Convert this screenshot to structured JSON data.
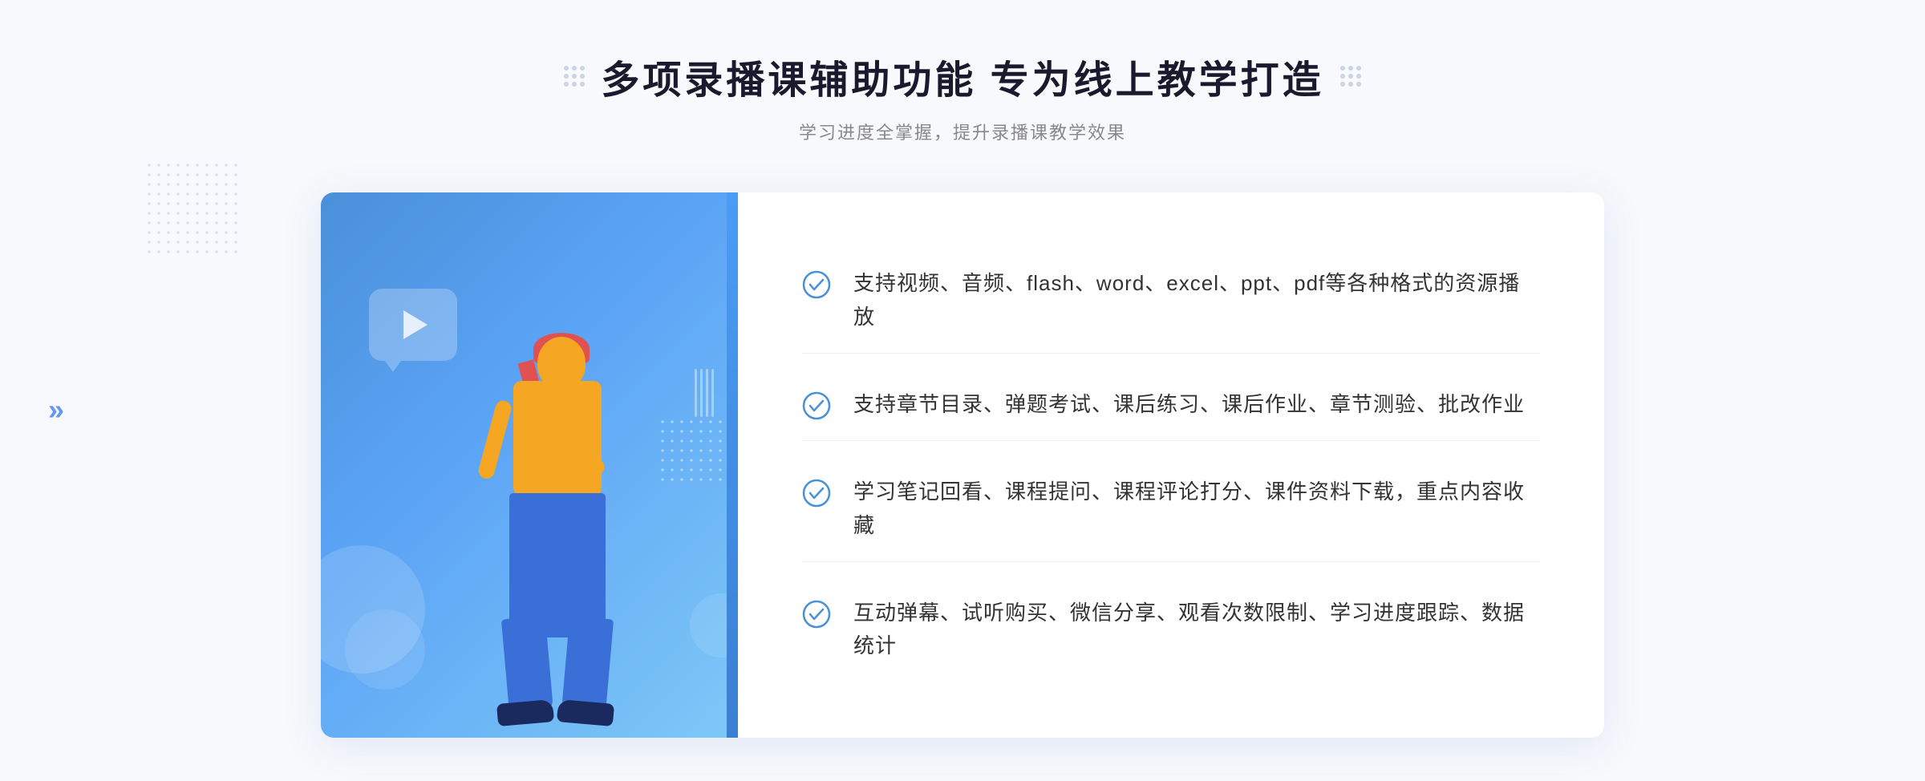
{
  "page": {
    "background_color": "#f8f9fc"
  },
  "header": {
    "main_title": "多项录播课辅助功能 专为线上教学打造",
    "subtitle": "学习进度全掌握，提升录播课教学效果"
  },
  "features": [
    {
      "id": 1,
      "text": "支持视频、音频、flash、word、excel、ppt、pdf等各种格式的资源播放"
    },
    {
      "id": 2,
      "text": "支持章节目录、弹题考试、课后练习、课后作业、章节测验、批改作业"
    },
    {
      "id": 3,
      "text": "学习笔记回看、课程提问、课程评论打分、课件资料下载，重点内容收藏"
    },
    {
      "id": 4,
      "text": "互动弹幕、试听购买、微信分享、观看次数限制、学习进度跟踪、数据统计"
    }
  ],
  "icons": {
    "check_circle": "check-circle",
    "play": "play-icon",
    "chevron_right": "»"
  },
  "colors": {
    "primary_blue": "#4a90d9",
    "accent_blue": "#3a7fd4",
    "check_color": "#4a90d9",
    "title_color": "#1a1a2e",
    "subtitle_color": "#888888",
    "text_color": "#333333"
  }
}
